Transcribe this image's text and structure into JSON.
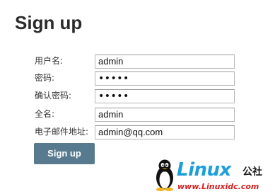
{
  "page": {
    "title": "Sign up"
  },
  "form": {
    "fields": [
      {
        "label": "用户名:",
        "value": "admin",
        "type": "text"
      },
      {
        "label": "密码:",
        "value": "•••••",
        "type": "password"
      },
      {
        "label": "确认密码:",
        "value": "•••••",
        "type": "password"
      },
      {
        "label": "全名:",
        "value": "admin",
        "type": "text"
      },
      {
        "label": "电子邮件地址:",
        "value": "admin@qq.com",
        "type": "text"
      }
    ],
    "submit_label": "Sign up"
  },
  "watermark": {
    "logo_text": "Linux",
    "logo_cn": "公社",
    "url": "www.Linuxidc.com",
    "icon": "penguin-icon",
    "colors": {
      "logo": "#1d9fd9",
      "url": "#d32020"
    }
  },
  "colors": {
    "button_bg": "#577a8e",
    "button_text": "#ffffff"
  }
}
